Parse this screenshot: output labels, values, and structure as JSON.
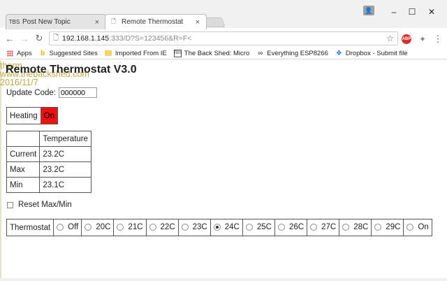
{
  "tabs": [
    {
      "label": "Post New Topic",
      "icon": "tbs-favicon"
    },
    {
      "label": "Remote Thermostat",
      "icon": "page-icon"
    }
  ],
  "window": {
    "minimize": "–",
    "maximize": "☐",
    "close": "✕"
  },
  "address": {
    "host": "192.168.1.145",
    "rest": ":333/D?S=123456&R=F<"
  },
  "bookmarks": [
    {
      "label": "Apps",
      "icon": "apps-grid-icon"
    },
    {
      "label": "Suggested Sites",
      "icon": "bing-icon"
    },
    {
      "label": "Imported From IE",
      "icon": "folder-icon"
    },
    {
      "label": "The Back Shed: Micro",
      "icon": "tbs-icon"
    },
    {
      "label": "Everything ESP8266",
      "icon": "esp-icon"
    },
    {
      "label": "Dropbox - Submit file",
      "icon": "dropbox-icon"
    }
  ],
  "page": {
    "ghost_lines": [
      "therm",
      "www.thebackshed.com",
      "2016/11/7"
    ],
    "title": "Remote Thermostat V3.0",
    "update_code_label": "Update Code:",
    "update_code_value": "000000",
    "heating_label": "Heating",
    "heating_state": "On",
    "temp_table": {
      "header": "Temperature",
      "rows": [
        {
          "label": "Current",
          "value": "23.2C"
        },
        {
          "label": "Max",
          "value": "23.2C"
        },
        {
          "label": "Min",
          "value": "23.1C"
        }
      ]
    },
    "reset_label": "Reset Max/Min",
    "thermostat_label": "Thermostat",
    "thermostat_options": [
      "Off",
      "20C",
      "21C",
      "22C",
      "23C",
      "24C",
      "25C",
      "26C",
      "27C",
      "28C",
      "29C",
      "On"
    ],
    "thermostat_selected": "24C"
  },
  "colors": {
    "heating_on": "#ee1111",
    "ghost_text": "#b59a2a"
  }
}
